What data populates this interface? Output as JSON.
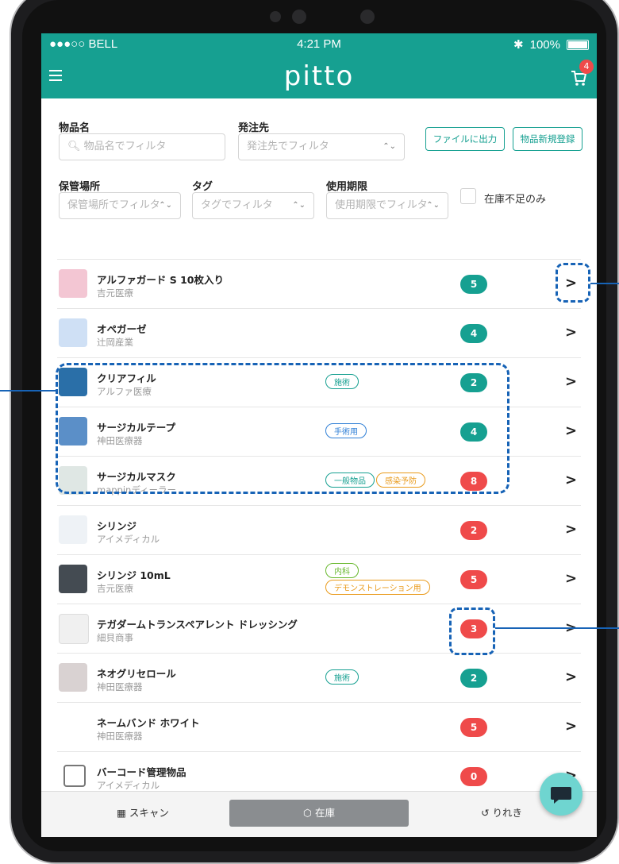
{
  "status": {
    "carrier": "●●●○○ BELL",
    "time": "4:21 PM",
    "battery": "100%"
  },
  "app": {
    "logo": "pitto",
    "cart_count": "4"
  },
  "filters": {
    "item_name_label": "物品名",
    "item_name_placeholder": "物品名でフィルタ",
    "supplier_label": "発注先",
    "supplier_placeholder": "発注先でフィルタ",
    "export_button": "ファイルに出力",
    "new_item_button": "物品新規登録",
    "storage_label": "保管場所",
    "storage_placeholder": "保管場所でフィルタ",
    "tag_label": "タグ",
    "tag_placeholder": "タグでフィルタ",
    "expiry_label": "使用期限",
    "expiry_placeholder": "使用期限でフィルタ",
    "shortage_only_label": "在庫不足のみ"
  },
  "items": [
    {
      "name": "アルファガード S 10枚入り",
      "supplier": "吉元医療",
      "tags": [],
      "count": "5",
      "status": "ok",
      "thumb_color": "#f3c6d3"
    },
    {
      "name": "オペガーゼ",
      "supplier": "辻岡産業",
      "tags": [],
      "count": "4",
      "status": "ok",
      "thumb_color": "#cfe0f5"
    },
    {
      "name": "クリアフィル",
      "supplier": "アルファ医療",
      "tags": [
        {
          "label": "施術",
          "color": "green"
        }
      ],
      "count": "2",
      "status": "ok",
      "thumb_color": "#2a6fa8"
    },
    {
      "name": "サージカルテープ",
      "supplier": "神田医療器",
      "tags": [
        {
          "label": "手術用",
          "color": "blue"
        }
      ],
      "count": "4",
      "status": "ok",
      "thumb_color": "#5b8fc8"
    },
    {
      "name": "サージカルマスク",
      "supplier": "mappinディーラー",
      "tags": [
        {
          "label": "一般物品",
          "color": "green"
        },
        {
          "label": "感染予防",
          "color": "orange"
        }
      ],
      "count": "8",
      "status": "low",
      "thumb_color": "#dfe7e4"
    },
    {
      "name": "シリンジ",
      "supplier": "アイメディカル",
      "tags": [],
      "count": "2",
      "status": "low",
      "thumb_color": "#eef2f6"
    },
    {
      "name": "シリンジ 10mL",
      "supplier": "吉元医療",
      "tags": [
        {
          "label": "内科",
          "color": "yellowgreen"
        },
        {
          "label": "デモンストレーション用",
          "color": "orange"
        }
      ],
      "count": "5",
      "status": "low",
      "thumb_color": "#444b52"
    },
    {
      "name": "テガダームトランスペアレント ドレッシング",
      "supplier": "細貝商事",
      "tags": [],
      "count": "3",
      "status": "low",
      "thumb_color": "#f0f0f0"
    },
    {
      "name": "ネオグリセロール",
      "supplier": "神田医療器",
      "tags": [
        {
          "label": "施術",
          "color": "green"
        }
      ],
      "count": "2",
      "status": "ok",
      "thumb_color": "#d9d2d2"
    },
    {
      "name": "ネームバンド ホワイト",
      "supplier": "神田医療器",
      "tags": [],
      "count": "5",
      "status": "low",
      "thumb_color": "#ffffff"
    },
    {
      "name": "バーコード管理物品",
      "supplier": "アイメディカル",
      "tags": [],
      "count": "0",
      "status": "low",
      "thumb_color": "#ffffff"
    }
  ],
  "bottom_nav": {
    "scan": "スキャン",
    "stock": "在庫",
    "history": "りれき"
  },
  "colors": {
    "brand": "#16a091",
    "danger": "#ef4a4a",
    "annotation": "#1763b6"
  }
}
